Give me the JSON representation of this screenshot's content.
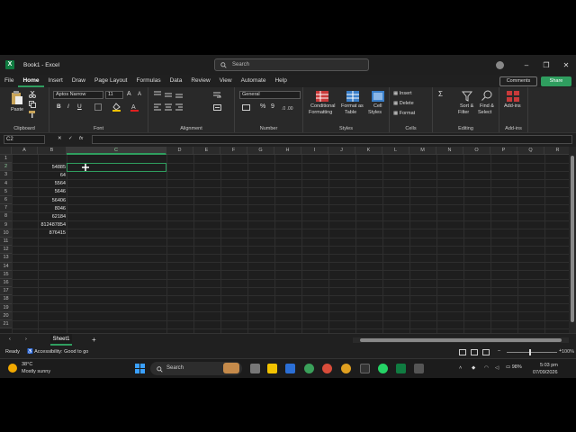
{
  "window": {
    "title": "Book1  -  Excel"
  },
  "search": {
    "placeholder": "Search"
  },
  "menu": [
    "File",
    "Home",
    "Insert",
    "Draw",
    "Page Layout",
    "Formulas",
    "Data",
    "Review",
    "View",
    "Automate",
    "Help"
  ],
  "menu_active": "Home",
  "buttons": {
    "comments": "Comments",
    "share": "Share"
  },
  "ribbon": {
    "clipboard": {
      "paste": "Paste",
      "label": "Clipboard"
    },
    "font": {
      "name": "Aptos Narrow",
      "size": "11",
      "label": "Font",
      "bold": "B",
      "italic": "I",
      "underline": "U",
      "grow": "A",
      "shrink": "A"
    },
    "alignment": {
      "label": "Alignment"
    },
    "number": {
      "format": "General",
      "label": "Number",
      "percent": "%",
      "comma": "9"
    },
    "styles": {
      "conditional": "Conditional",
      "conditional2": "Formatting",
      "format_table": "Format as",
      "format_table2": "Table",
      "cell_styles": "Cell",
      "cell_styles2": "Styles",
      "label": "Styles"
    },
    "cells": {
      "insert": "Insert",
      "delete": "Delete",
      "format": "Format",
      "label": "Cells"
    },
    "editing": {
      "sort": "Sort &",
      "sort2": "Filter",
      "find": "Find &",
      "find2": "Select",
      "label": "Editing"
    },
    "addins": {
      "addins": "Add-ins",
      "label": "Add-ins"
    }
  },
  "formula_bar": {
    "name_box": "C2",
    "fx": "fx",
    "value": ""
  },
  "columns": [
    "A",
    "B",
    "C",
    "D",
    "E",
    "F",
    "G",
    "H",
    "I",
    "J",
    "K",
    "L",
    "M",
    "N",
    "O",
    "P",
    "Q",
    "R"
  ],
  "rows": [
    "1",
    "2",
    "3",
    "4",
    "5",
    "6",
    "7",
    "8",
    "9",
    "10",
    "11",
    "12",
    "13",
    "14",
    "15",
    "16",
    "17",
    "18",
    "19",
    "20",
    "21"
  ],
  "column_b_values": [
    "54885",
    "64",
    "5564",
    "5646",
    "56406",
    "8046",
    "62184",
    "812487854",
    "876415"
  ],
  "selected_cell": "C2",
  "sheet": {
    "tab": "Sheet1",
    "add": "+"
  },
  "status": {
    "ready": "Ready",
    "accessibility": "Accessibility: Good to go",
    "zoom": "100%"
  },
  "taskbar": {
    "weather_temp": "38°C",
    "weather_desc": "Mostly sunny",
    "search": "Search",
    "battery": "98%",
    "time": "5:03 pm",
    "date": "07/09/2026"
  },
  "colors": {
    "accent": "#2f9e5f",
    "background": "#1e1e1e"
  }
}
